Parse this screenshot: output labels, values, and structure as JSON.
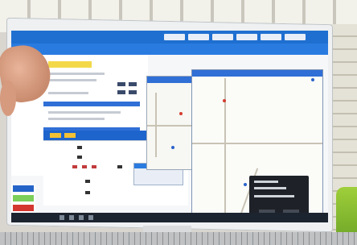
{
  "scene": {
    "description_colors": {
      "ui_primary": "#1f6fd0",
      "highlight": "#f3d94a",
      "alert": "#d4372f",
      "taskbar": "#1c2430"
    }
  },
  "icons": [
    "taskbar-icon",
    "map-marker-icon"
  ]
}
